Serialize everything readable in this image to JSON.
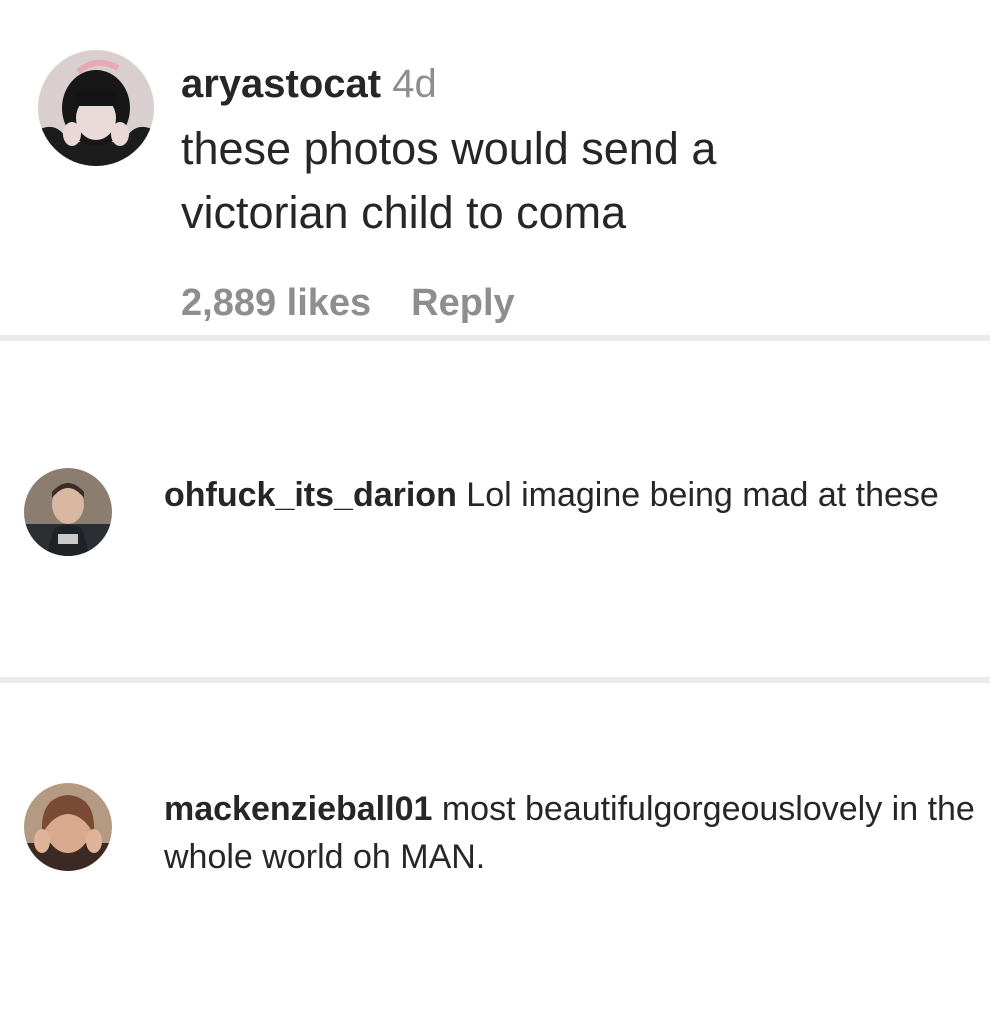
{
  "comments": [
    {
      "username": "aryastocat",
      "time": "4d",
      "text": "these photos would send a victorian child to coma",
      "likes": "2,889 likes",
      "reply_label": "Reply"
    },
    {
      "username": "ohfuck_its_darion",
      "text": "Lol imagine being mad at these"
    },
    {
      "username": "mackenzieball01",
      "text": "most beautifulgorgeouslovely in the whole world oh MAN."
    }
  ]
}
